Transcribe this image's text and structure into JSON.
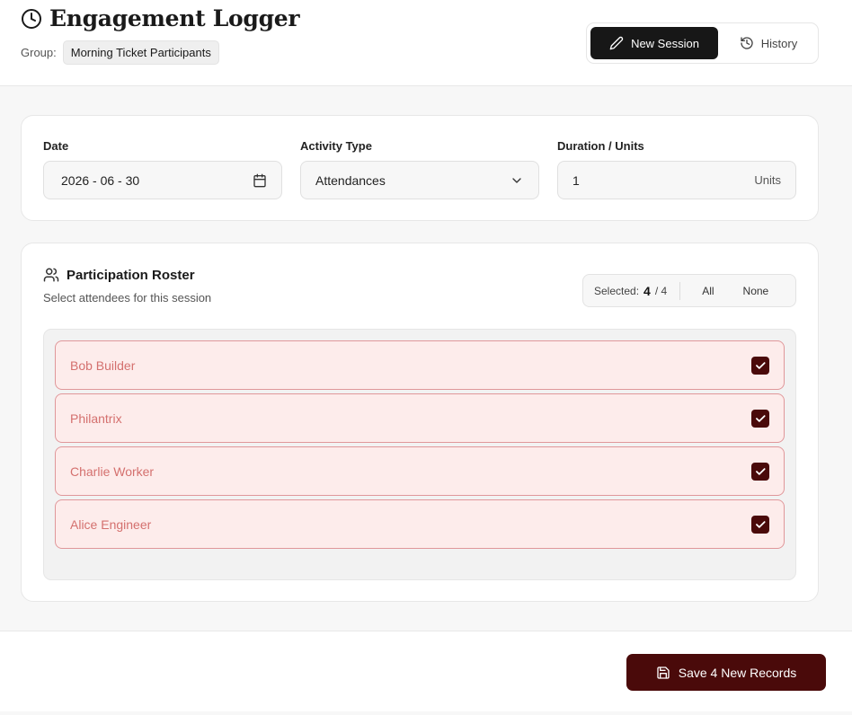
{
  "header": {
    "title": "Engagement Logger",
    "group_label": "Group:",
    "group_name": "Morning Ticket Participants",
    "tabs": [
      {
        "label": "New Session",
        "icon": "pencil-icon",
        "active": true
      },
      {
        "label": "History",
        "icon": "history-icon",
        "active": false
      }
    ]
  },
  "form": {
    "date": {
      "label": "Date",
      "value": "2026 - 06 - 30"
    },
    "activity": {
      "label": "Activity Type",
      "value": "Attendances"
    },
    "duration": {
      "label": "Duration / Units",
      "value": "1",
      "unit": "Units"
    }
  },
  "roster": {
    "title": "Participation Roster",
    "subtitle": "Select attendees for this session",
    "selected_label": "Selected:",
    "selected_count": "4",
    "total": "/ 4",
    "all_label": "All",
    "none_label": "None",
    "people": [
      {
        "name": "Bob Builder",
        "checked": true
      },
      {
        "name": "Philantrix",
        "checked": true
      },
      {
        "name": "Charlie Worker",
        "checked": true
      },
      {
        "name": "Alice Engineer",
        "checked": true
      }
    ]
  },
  "footer": {
    "save_label": "Save 4 New Records"
  },
  "colors": {
    "accent": "#4a0a0a",
    "row_bg": "#fdeceb",
    "row_border": "#e0979a",
    "row_text": "#d4706e",
    "active_tab": "#171717"
  }
}
